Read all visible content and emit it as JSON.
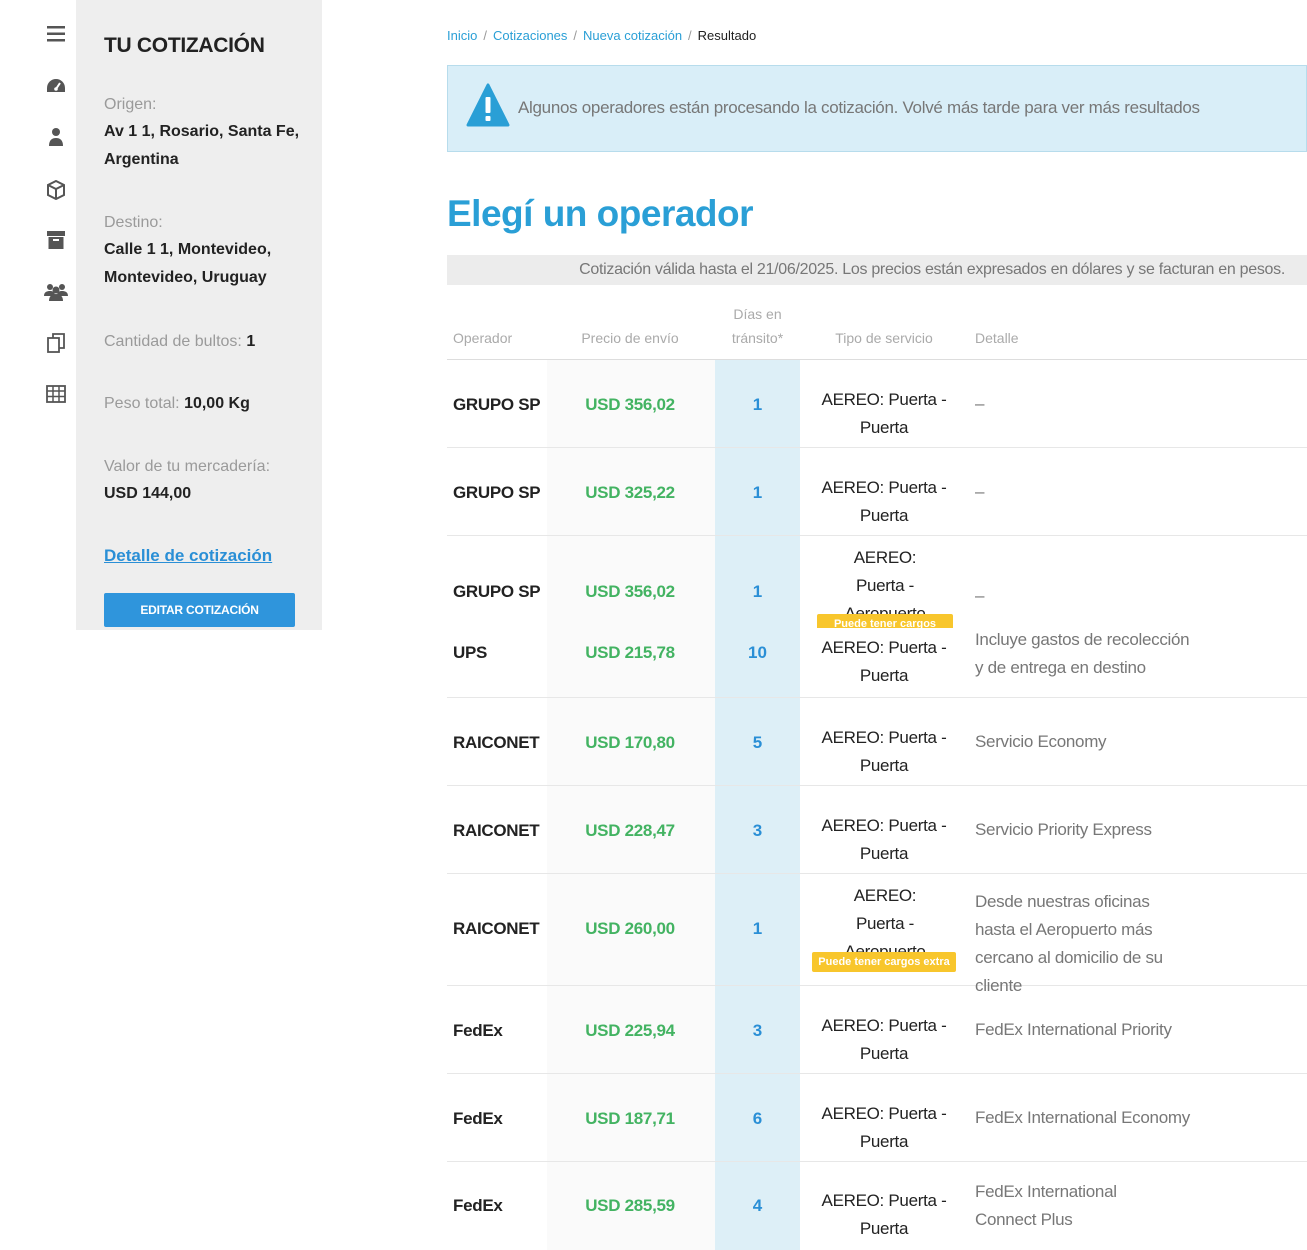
{
  "sidebar_icons": [
    "menu-icon",
    "dashboard-icon",
    "user-icon",
    "box-icon",
    "archive-icon",
    "users-icon",
    "copy-icon",
    "table-icon"
  ],
  "summary": {
    "title": "TU COTIZACIÓN",
    "origin_label": "Origen:",
    "origin_value": "Av 1 1, Rosario, Santa Fe, Argentina",
    "destination_label": "Destino:",
    "destination_value": "Calle 1 1, Montevideo, Montevideo, Uruguay",
    "packages_label": "Cantidad de bultos:",
    "packages_value": "1",
    "weight_label": "Peso total:",
    "weight_value": "10,00 Kg",
    "goods_value_label": "Valor de tu mercadería:",
    "goods_value": "USD 144,00",
    "detail_link": "Detalle de cotización",
    "edit_button": "EDITAR COTIZACIÓN"
  },
  "breadcrumb": {
    "items": [
      "Inicio",
      "Cotizaciones",
      "Nueva cotización"
    ],
    "current": "Resultado",
    "separator": "/"
  },
  "alert": {
    "text": "Algunos operadores están procesando la cotización. Volvé más tarde para ver más resultados"
  },
  "heading": "Elegí un operador",
  "validity": "Cotización válida hasta el 21/06/2025. Los precios están expresados en dólares y se facturan en pesos.",
  "table": {
    "headers": {
      "operator": "Operador",
      "price": "Precio de envío",
      "days_line1": "Días en",
      "days_line2": "tránsito*",
      "service": "Tipo de servicio",
      "detail": "Detalle"
    },
    "badge_text": "Puede tener cargos extra",
    "rows": [
      {
        "operator": "GRUPO SP",
        "price": "USD 356,02",
        "days": "1",
        "service": "AEREO: Puerta - Puerta",
        "detail": "–"
      },
      {
        "operator": "GRUPO SP",
        "price": "USD 325,22",
        "days": "1",
        "service": "AEREO: Puerta - Puerta",
        "detail": "–"
      },
      {
        "operator": "GRUPO SP",
        "price": "USD 356,02",
        "days": "1",
        "service": "AEREO: Puerta - Aeropuerto",
        "detail": "–"
      },
      {
        "operator": "UPS",
        "price": "USD 215,78",
        "days": "10",
        "service": "AEREO: Puerta - Puerta",
        "detail": "Incluye gastos de recolección y de entrega en destino"
      },
      {
        "operator": "RAICONET",
        "price": "USD 170,80",
        "days": "5",
        "service": "AEREO: Puerta - Puerta",
        "detail": "Servicio Economy"
      },
      {
        "operator": "RAICONET",
        "price": "USD 228,47",
        "days": "3",
        "service": "AEREO: Puerta - Puerta",
        "detail": "Servicio Priority Express"
      },
      {
        "operator": "RAICONET",
        "price": "USD 260,00",
        "days": "1",
        "service": "AEREO: Puerta - Aeropuerto",
        "detail": "Desde nuestras oficinas hasta el Aeropuerto más cercano al domicilio de su cliente"
      },
      {
        "operator": "FedEx",
        "price": "USD 225,94",
        "days": "3",
        "service": "AEREO: Puerta - Puerta",
        "detail": "FedEx International Priority"
      },
      {
        "operator": "FedEx",
        "price": "USD 187,71",
        "days": "6",
        "service": "AEREO: Puerta - Puerta",
        "detail": "FedEx International Economy"
      },
      {
        "operator": "FedEx",
        "price": "USD 285,59",
        "days": "4",
        "service": "AEREO: Puerta - Puerta",
        "detail": "FedEx International Connect Plus"
      }
    ]
  },
  "colors": {
    "accent": "#2a9fd6",
    "price_green": "#43b362",
    "badge_yellow": "#f8c62c",
    "alert_bg": "#d9eef8"
  }
}
